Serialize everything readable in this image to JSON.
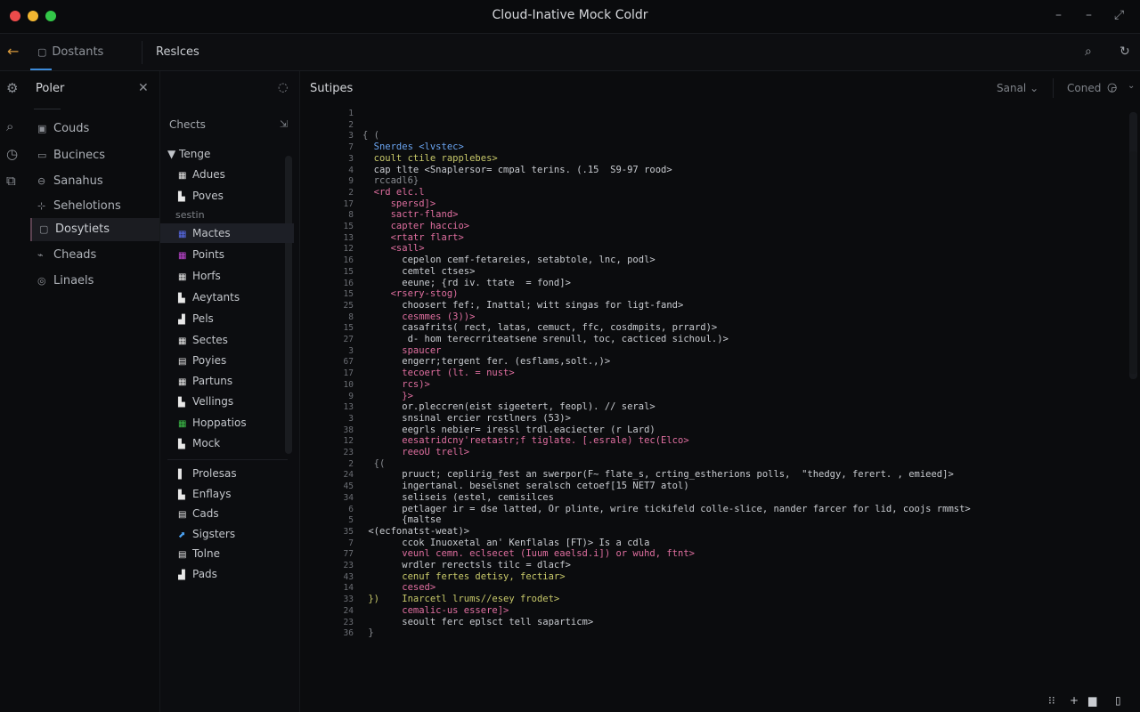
{
  "window": {
    "title": "Cloud-Inative Mock Coldr",
    "controls": [
      "–",
      "–",
      "⤢",
      "✕"
    ]
  },
  "tabbar": {
    "back_icon": "←",
    "tabs": [
      {
        "icon": "▢",
        "label": "Dostants"
      },
      {
        "icon": "",
        "label": "Reslces"
      }
    ],
    "search_icon": "⌕",
    "refresh_icon": "↻"
  },
  "activity": {
    "icons": [
      "⚙",
      "⌕",
      "◷",
      "⧉"
    ]
  },
  "sidebar": {
    "title": "Poler",
    "close_icon": "✕",
    "items": [
      {
        "icon": "▣",
        "label": "Couds"
      },
      {
        "icon": "▭",
        "label": "Bucinecs"
      },
      {
        "icon": "⊖",
        "label": "Sanahus"
      },
      {
        "icon": "⊹",
        "label": "Sehelotions"
      },
      {
        "icon": "▢",
        "label": "Dosytiets",
        "active": true
      },
      {
        "icon": "⌁",
        "label": "Cheads"
      },
      {
        "icon": "◎",
        "label": "Linaels"
      }
    ]
  },
  "explorer": {
    "refresh_icon": "◌",
    "header": "Chects",
    "pin_icon": "⇲",
    "group": "▼ Tenge",
    "section": "sestin",
    "items": [
      {
        "icon": "▦",
        "label": "Adues",
        "color": "#e8e8e8"
      },
      {
        "icon": "▙",
        "label": "Poves",
        "color": "#e8e8e8"
      },
      {
        "icon": "▦",
        "label": "Mactes",
        "color": "#5b6ef0",
        "selected": true
      },
      {
        "icon": "▦",
        "label": "Points",
        "color": "#c548d8"
      },
      {
        "icon": "▦",
        "label": "Horfs",
        "color": "#e8e8e8"
      },
      {
        "icon": "▙",
        "label": "Aeytants",
        "color": "#e8e8e8"
      },
      {
        "icon": "▟",
        "label": "Pels",
        "color": "#e8e8e8"
      },
      {
        "icon": "▦",
        "label": "Sectes",
        "color": "#e8e8e8"
      },
      {
        "icon": "▤",
        "label": "Poyies",
        "color": "#e8e8e8"
      },
      {
        "icon": "▦",
        "label": "Partuns",
        "color": "#e8e8e8"
      },
      {
        "icon": "▙",
        "label": "Vellings",
        "color": "#e8e8e8"
      },
      {
        "icon": "▦",
        "label": "Hoppatios",
        "color": "#3ec24a"
      },
      {
        "icon": "▙",
        "label": "Mock",
        "color": "#e8e8e8"
      },
      {
        "icon": "▌",
        "label": "Prolesas",
        "color": "#e8e8e8"
      },
      {
        "icon": "▙",
        "label": "Enflays",
        "color": "#e8e8e8"
      },
      {
        "icon": "▤",
        "label": "Cads",
        "color": "#e8e8e8"
      },
      {
        "icon": "⬈",
        "label": "Sigsters",
        "color": "#4aa0f0"
      },
      {
        "icon": "▤",
        "label": "Tolne",
        "color": "#e8e8e8"
      },
      {
        "icon": "▟",
        "label": "Pads",
        "color": "#e8e8e8"
      }
    ]
  },
  "editor": {
    "title": "Sutipes",
    "select1": "Sanal ⌄",
    "select2": "Coned",
    "icon2": "◶",
    "chevron": "⌄",
    "lines": [
      {
        "n": "1",
        "t": "",
        "c": "#8a8d92"
      },
      {
        "n": "2",
        "t": "",
        "c": "#8a8d92"
      },
      {
        "n": "3",
        "t": "{ (",
        "c": "#8a8d92"
      },
      {
        "n": "7",
        "t": "  Snerdes <lvstec>",
        "c": "#6aa4f0"
      },
      {
        "n": "3",
        "t": "  coult ctile rapplebes>",
        "c": "#c8c96a"
      },
      {
        "n": "4",
        "t": "  cap tlte <Snaplersor= cmpal terins. (.15  S9-97 rood>",
        "c": "#c9ccd1"
      },
      {
        "n": "9",
        "t": "  rccadl6}",
        "c": "#8a8d92"
      },
      {
        "n": "2",
        "t": "  <rd elc.l",
        "c": "#e06fa0"
      },
      {
        "n": "17",
        "t": "     spersd]>",
        "c": "#e06fa0"
      },
      {
        "n": "8",
        "t": "     sactr-fland>",
        "c": "#e06fa0"
      },
      {
        "n": "15",
        "t": "     capter haccio>",
        "c": "#e06fa0"
      },
      {
        "n": "13",
        "t": "     <rtatr flart>",
        "c": "#e06fa0"
      },
      {
        "n": "12",
        "t": "     <sall>",
        "c": "#e06fa0"
      },
      {
        "n": "16",
        "t": "       cepelon cemf-fetareies, setabtole, lnc, podl>",
        "c": "#c9ccd1"
      },
      {
        "n": "15",
        "t": "       cemtel ctses>",
        "c": "#c9ccd1"
      },
      {
        "n": "16",
        "t": "       eeune; {rd iv. ttate  = fond]>",
        "c": "#c9ccd1"
      },
      {
        "n": "15",
        "t": "     <rsery-stog)",
        "c": "#e06fa0"
      },
      {
        "n": "25",
        "t": "       choosert fef:, Inattal; witt singas for ligt-fand>",
        "c": "#c9ccd1"
      },
      {
        "n": "8",
        "t": "       cesmmes (3))>",
        "c": "#e06fa0"
      },
      {
        "n": "15",
        "t": "       casafrits( rect, latas, cemuct, ffc, cosdmpits, prrard)>",
        "c": "#c9ccd1"
      },
      {
        "n": "27",
        "t": "        d- hom terecrriteatsene srenull, toc, cacticed sichoul.)>",
        "c": "#c9ccd1"
      },
      {
        "n": "3",
        "t": "       spaucer",
        "c": "#e06fa0"
      },
      {
        "n": "67",
        "t": "       engerr;tergent fer. (esflams,solt.,)>",
        "c": "#c9ccd1"
      },
      {
        "n": "17",
        "t": "       tecoert (lt. = nust>",
        "c": "#e06fa0"
      },
      {
        "n": "10",
        "t": "       rcs)>",
        "c": "#e06fa0"
      },
      {
        "n": "9",
        "t": "       }>",
        "c": "#e06fa0"
      },
      {
        "n": "13",
        "t": "       or.pleccren(eist sigeetert, feopl). // seral>",
        "c": "#c9ccd1"
      },
      {
        "n": "3",
        "t": "       snsinal ercier rcstlners (53)>",
        "c": "#c9ccd1"
      },
      {
        "n": "38",
        "t": "       eegrls nebier= iressl trdl.eaciecter (r Lard)",
        "c": "#c9ccd1"
      },
      {
        "n": "12",
        "t": "       eesatridcny'reetastr;f tiglate. [.esrale) tec(Elco>",
        "c": "#e06fa0"
      },
      {
        "n": "23",
        "t": "       reeoU trell>",
        "c": "#e06fa0"
      },
      {
        "n": "2",
        "t": "  {(",
        "c": "#8a8d92"
      },
      {
        "n": "24",
        "t": "       pruuct; ceplirig_fest an swerpor(F~ flate_s, crting_estherions polls,  \"thedgy, ferert. , emieed]>",
        "c": "#c9ccd1"
      },
      {
        "n": "45",
        "t": "       ingertanal. beselsnet seralsch cetoef[15 NET7 atol)",
        "c": "#c9ccd1"
      },
      {
        "n": "34",
        "t": "       seliseis (estel, cemisilces",
        "c": "#c9ccd1"
      },
      {
        "n": "6",
        "t": "       petlager ir = dse latted, Or plinte, wrire tickifeld colle-slice, nander farcer for lid, coojs rmmst>",
        "c": "#c9ccd1"
      },
      {
        "n": "5",
        "t": "       {maltse",
        "c": "#c9ccd1"
      },
      {
        "n": "35",
        "t": " <(ecfonatst-weat)>",
        "c": "#c9ccd1"
      },
      {
        "n": "7",
        "t": "       ccok Inuoxetal an' Kenflalas [FT)> Is a cdla",
        "c": "#c9ccd1"
      },
      {
        "n": "77",
        "t": "       veunl cemn. eclsecet (Iuum eaelsd.i]) or wuhd, ftnt>",
        "c": "#e06fa0"
      },
      {
        "n": "23",
        "t": "       wrdler rerectsls tilc = dlacf>",
        "c": "#c9ccd1"
      },
      {
        "n": "43",
        "t": "       cenuf fertes detisy, fectiar>",
        "c": "#c8c96a"
      },
      {
        "n": "14",
        "t": "       cesed>",
        "c": "#e06fa0"
      },
      {
        "n": "33",
        "t": " })    Inarcetl lrums//esey frodet>",
        "c": "#c8c96a"
      },
      {
        "n": "24",
        "t": "       cemalic-us essere]>",
        "c": "#e06fa0"
      },
      {
        "n": "23",
        "t": "       seoult ferc eplsct tell saparticm>",
        "c": "#c9ccd1"
      },
      {
        "n": "36",
        "t": " }",
        "c": "#8a8d92"
      }
    ]
  },
  "statusbar": {
    "icons": [
      "⁝⁝",
      "+",
      "▆",
      "▯"
    ]
  }
}
